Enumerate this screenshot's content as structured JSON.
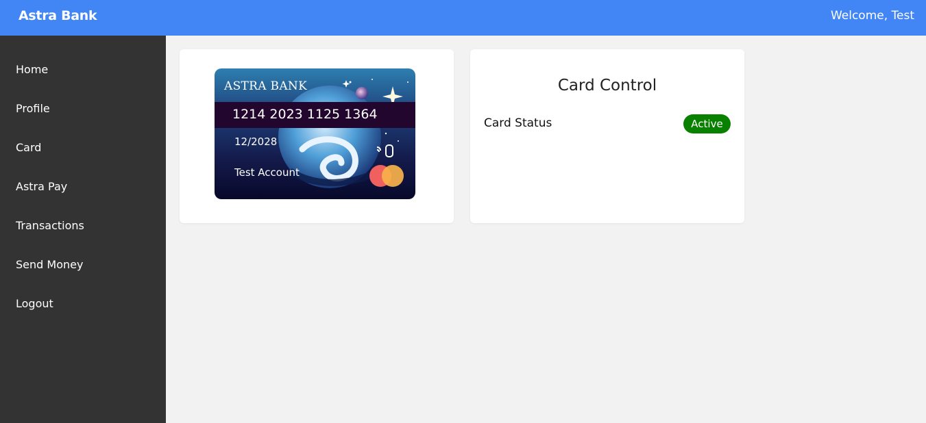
{
  "header": {
    "brand": "Astra Bank",
    "welcome": "Welcome, Test"
  },
  "sidebar": {
    "items": [
      {
        "label": "Home"
      },
      {
        "label": "Profile"
      },
      {
        "label": "Card"
      },
      {
        "label": "Astra Pay"
      },
      {
        "label": "Transactions"
      },
      {
        "label": "Send Money"
      },
      {
        "label": "Logout"
      }
    ]
  },
  "card": {
    "bank_name": "ASTRA BANK",
    "number": "1214 2023 1125 1364",
    "expiry": "12/2028",
    "holder": "Test Account",
    "contactless_icon": "contactless-icon",
    "network_icon": "mastercard-logo-icon"
  },
  "card_control": {
    "title": "Card Control",
    "status_label": "Card Status",
    "status_value": "Active"
  },
  "colors": {
    "header_bg": "#4285f4",
    "sidebar_bg": "#333333",
    "page_bg": "#f2f2f2",
    "active_badge": "#0a8000",
    "card_number_band": "#22062e"
  }
}
